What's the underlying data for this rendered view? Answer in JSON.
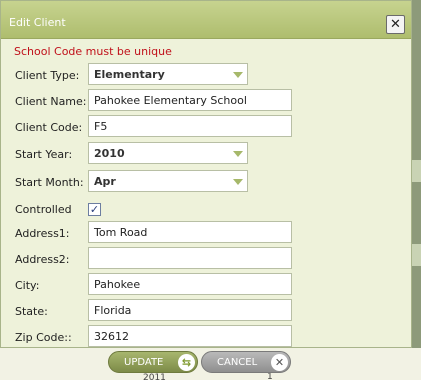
{
  "dialog": {
    "title": "Edit Client",
    "close_label": "✕",
    "error_message": "School Code must be unique"
  },
  "form": {
    "client_type": {
      "label": "Client Type:",
      "value": "Elementary"
    },
    "client_name": {
      "label": "Client Name:",
      "value": "Pahokee Elementary School"
    },
    "client_code": {
      "label": "Client Code:",
      "value": "F5"
    },
    "start_year": {
      "label": "Start Year:",
      "value": "2010"
    },
    "start_month": {
      "label": "Start Month:",
      "value": "Apr"
    },
    "controlled": {
      "label": "Controlled",
      "checked": true,
      "mark": "✓"
    },
    "address1": {
      "label": "Address1:",
      "value": "Tom Road"
    },
    "address2": {
      "label": "Address2:",
      "value": ""
    },
    "city": {
      "label": "City:",
      "value": "Pahokee"
    },
    "state": {
      "label": "State:",
      "value": "Florida"
    },
    "zip_code": {
      "label": "Zip Code::",
      "value": "32612"
    }
  },
  "buttons": {
    "update": {
      "label": "UPDATE",
      "icon": "refresh-icon",
      "glyph": "⇆"
    },
    "cancel": {
      "label": "CANCEL",
      "icon": "close-circle-icon",
      "glyph": "✕"
    }
  },
  "background": {
    "year_text": "2011",
    "num_text": "1"
  },
  "colors": {
    "titlebar": "#b6c47c",
    "dialog_bg": "#eef2da",
    "error": "#c0101a",
    "update_button": "#8d9b55",
    "cancel_button": "#a3a3a3"
  }
}
